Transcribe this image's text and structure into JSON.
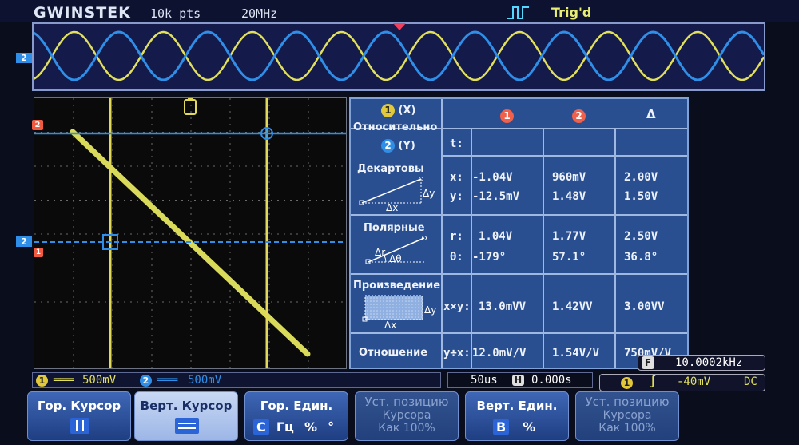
{
  "header": {
    "brand": "GWINSTEK",
    "sample_rate": "10k pts",
    "bandwidth": "20MHz",
    "trigger_status": "Trig'd"
  },
  "colors": {
    "ch1": "#e2e05a",
    "ch2": "#2f8fe8",
    "table_bg": "#2a4f90",
    "accent": "#e8ee70"
  },
  "table": {
    "row_labels": {
      "header_x": "(X)",
      "header_rel": "Относительно",
      "header_y": "(Y)",
      "time": "Декартовы",
      "polar": "Полярные",
      "product": "Произведение",
      "ratio": "Отношение"
    },
    "col_headers": [
      "1",
      "2",
      "Δ"
    ],
    "t_label": "t:",
    "cartesian": {
      "x_label": "x:",
      "y_label": "y:",
      "x": [
        "-1.04V",
        "960mV",
        "2.00V"
      ],
      "y": [
        "-12.5mV",
        "1.48V",
        "1.50V"
      ]
    },
    "polar": {
      "r_label": "r:",
      "theta_label": "θ:",
      "r": [
        "1.04V",
        "1.77V",
        "2.50V"
      ],
      "theta": [
        "-179°",
        "57.1°",
        "36.8°"
      ]
    },
    "product": {
      "label": "x×y:",
      "values": [
        "13.0mVV",
        "1.42VV",
        "3.00VV"
      ]
    },
    "ratio": {
      "label": "y÷x:",
      "values": [
        "12.0mV/V",
        "1.54V/V",
        "750mV/V"
      ]
    },
    "diagram_labels": {
      "dy": "Δy",
      "dx": "Δx",
      "dr": "Δr",
      "dtheta": "Δθ"
    }
  },
  "status": {
    "ch1_scale": "500mV",
    "ch2_scale": "500mV",
    "timebase": "50us",
    "h_position": "0.000s",
    "frequency": "10.0002kHz",
    "trigger_level": "-40mV",
    "coupling": "DC"
  },
  "softkeys": {
    "h_cursor": "Гор. Курсор",
    "v_cursor": "Верт. Курсор",
    "h_units": "Гор. Един.",
    "h_units_opts": [
      "С",
      "Гц",
      "%",
      "°"
    ],
    "set_pos_1": [
      "Уст. позицию",
      "Курсора",
      "Как 100%"
    ],
    "v_units": "Верт. Един.",
    "v_units_opts": [
      "В",
      "%"
    ],
    "set_pos_2": [
      "Уст. позицию",
      "Курсора",
      "Как 100%"
    ]
  }
}
